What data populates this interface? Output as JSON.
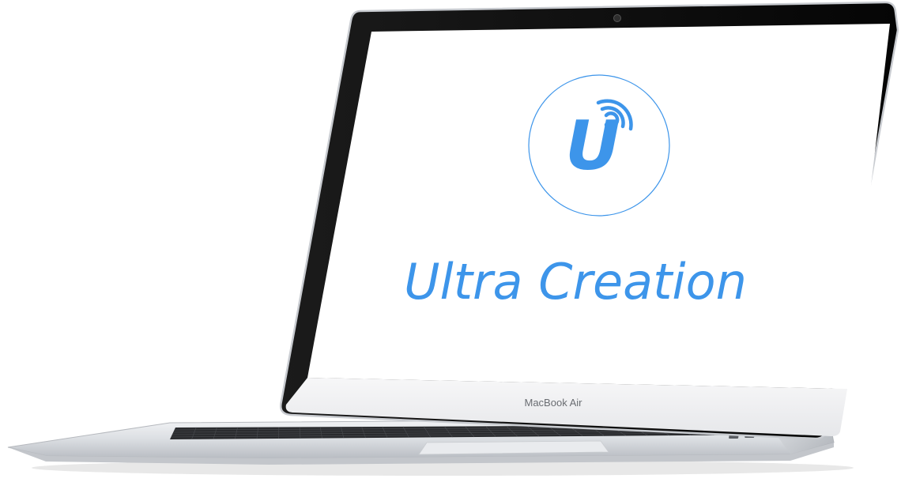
{
  "screen": {
    "logo_letter": "U",
    "brand_name": "Ultra Creation",
    "brand_color": "#3d95ea",
    "background_color": "#ffffff"
  },
  "device": {
    "model_label": "MacBook Air",
    "bezel_color": "#0d0d0d",
    "body_color": "#e4e6e9"
  },
  "icons": {
    "logo": "u-wifi-logo-icon",
    "camera": "camera-icon",
    "keyboard": "keyboard-icon",
    "trackpad": "trackpad-icon",
    "ports": "usb-port-icon"
  }
}
